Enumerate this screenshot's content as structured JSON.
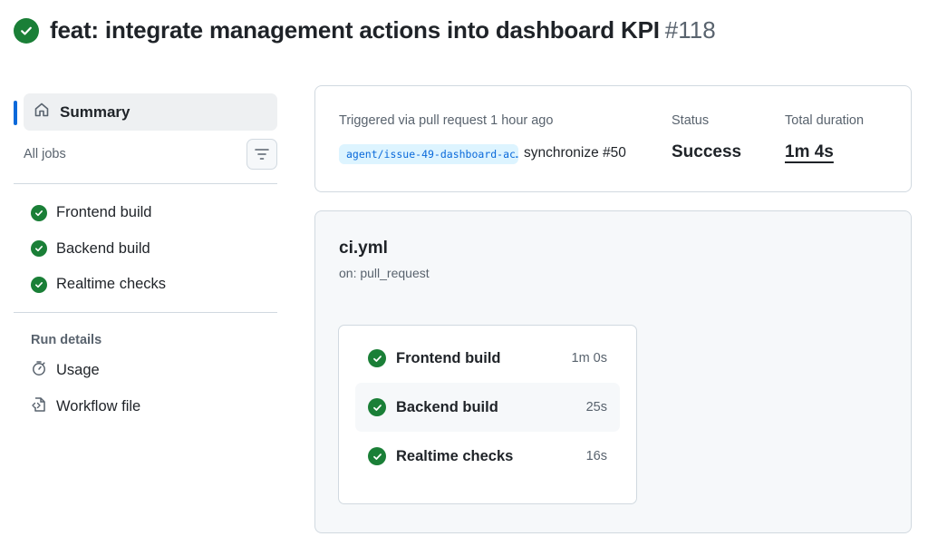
{
  "header": {
    "title": "feat: integrate management actions into dashboard KPI",
    "run_number": "#118",
    "status_icon": "check-circle-icon",
    "status_color": "#1a7f37"
  },
  "sidebar": {
    "summary_label": "Summary",
    "all_jobs_label": "All jobs",
    "jobs": [
      {
        "label": "Frontend build",
        "icon": "check-circle-icon"
      },
      {
        "label": "Backend build",
        "icon": "check-circle-icon"
      },
      {
        "label": "Realtime checks",
        "icon": "check-circle-icon"
      }
    ],
    "run_details_label": "Run details",
    "details": [
      {
        "label": "Usage",
        "icon": "stopwatch-icon"
      },
      {
        "label": "Workflow file",
        "icon": "file-code-icon"
      }
    ]
  },
  "summary": {
    "triggered_label": "Triggered via pull request 1 hour ago",
    "branch": "agent/issue-49-dashboard-ac…",
    "event": "synchronize #50",
    "status_label": "Status",
    "status_value": "Success",
    "duration_label": "Total duration",
    "duration_value": "1m 4s"
  },
  "workflow": {
    "name": "ci.yml",
    "trigger": "on: pull_request",
    "jobs": [
      {
        "name": "Frontend build",
        "time": "1m 0s"
      },
      {
        "name": "Backend build",
        "time": "25s"
      },
      {
        "name": "Realtime checks",
        "time": "16s"
      }
    ]
  },
  "colors": {
    "accent": "#0969da",
    "success": "#1a7f37",
    "branch_bg": "#ddf4ff"
  }
}
